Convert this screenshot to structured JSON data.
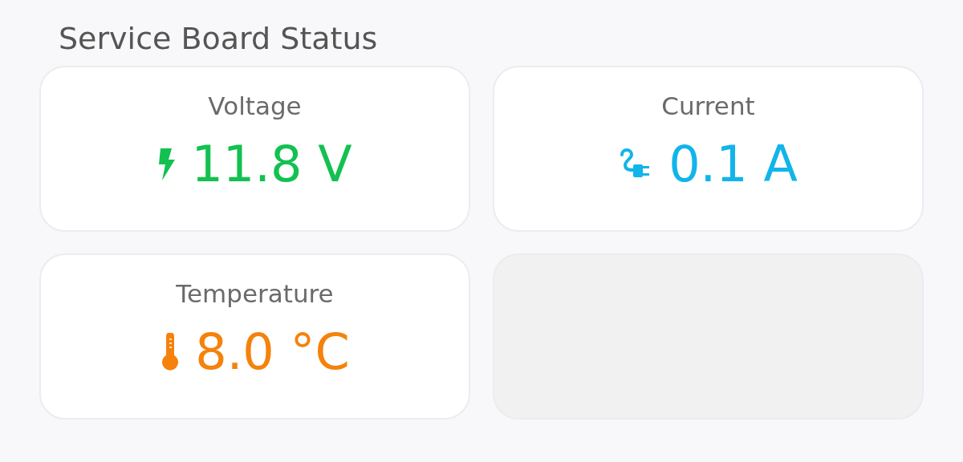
{
  "title": "Service Board Status",
  "cards": [
    {
      "kind": "bolt",
      "label": "Voltage",
      "value": "11.8 V",
      "color": "#12c150"
    },
    {
      "kind": "plug",
      "label": "Current",
      "value": "0.1 A",
      "color": "#12b4ea"
    },
    {
      "kind": "thermometer",
      "label": "Temperature",
      "value": "8.0 °C",
      "color": "#f5820c"
    },
    {
      "kind": "empty"
    }
  ]
}
